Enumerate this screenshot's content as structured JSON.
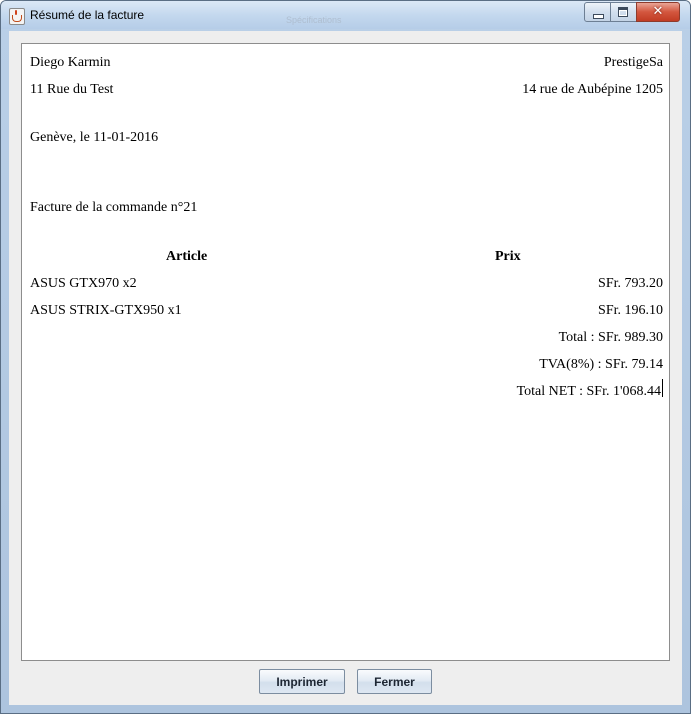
{
  "window": {
    "title": "Résumé de la facture",
    "background_title": "Spécifications"
  },
  "invoice": {
    "client_name": "Diego Karmin",
    "client_address": "11 Rue du Test",
    "company_name": "PrestigeSa",
    "company_address": "14 rue de Aubépine 1205",
    "date_line": "Genève, le 11-01-2016",
    "order_line": "Facture de la commande n°21",
    "columns": {
      "article": "Article",
      "price": "Prix"
    },
    "items": [
      {
        "article": "ASUS GTX970 x2",
        "price": "SFr. 793.20"
      },
      {
        "article": "ASUS STRIX-GTX950 x1",
        "price": "SFr. 196.10"
      }
    ],
    "total": "Total : SFr. 989.30",
    "tva": "TVA(8%) : SFr. 79.14",
    "total_net": "Total NET : SFr. 1'068.44"
  },
  "buttons": {
    "print": "Imprimer",
    "close": "Fermer"
  },
  "colors": {
    "title_bar": "#c4d8ee",
    "close_button": "#d3563e",
    "panel": "#eeeeee"
  }
}
